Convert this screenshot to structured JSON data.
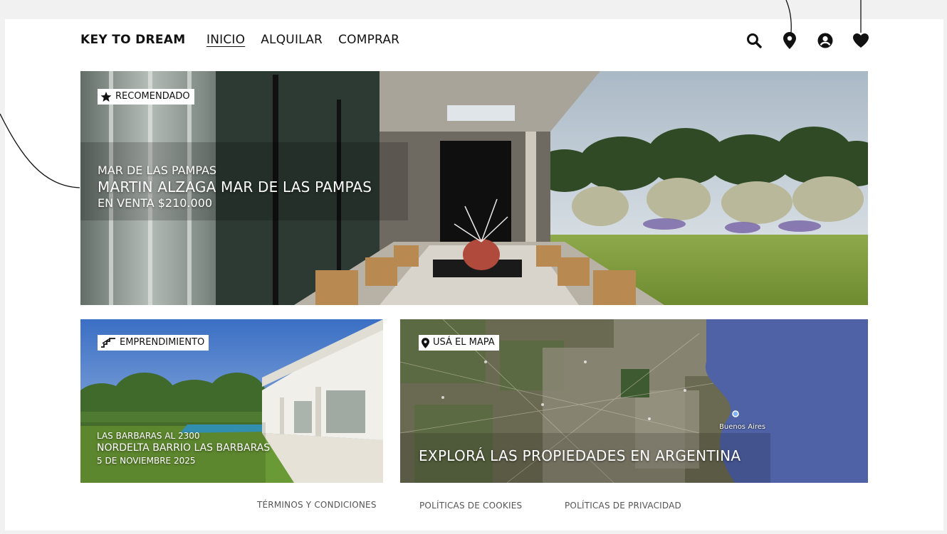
{
  "header": {
    "brand": "KEY TO DREAM",
    "nav": [
      "INICIO",
      "ALQUILAR",
      "COMPRAR"
    ],
    "active_nav": "INICIO",
    "icons": [
      "search-icon",
      "map-pin-icon",
      "user-icon",
      "heart-icon"
    ]
  },
  "featured": {
    "tag": "RECOMENDADO",
    "tag_icon": "star-icon",
    "location": "MAR DE LAS PAMPAS",
    "title": "MARTIN ALZAGA MAR DE LAS PAMPAS",
    "price": "EN VENTA $210.000"
  },
  "development": {
    "tag": "EMPRENDIMIENTO",
    "tag_icon": "stairs-icon",
    "address": "LAS BARBARAS AL 2300",
    "title": "NORDELTA BARRIO LAS BARBARAS",
    "date": "5 DE NOVIEMBRE 2025"
  },
  "map": {
    "tag": "USÁ EL MAPA",
    "tag_icon": "map-pin-icon",
    "title": "EXPLORÁ LAS PROPIEDADES EN ARGENTINA",
    "city_label": "Buenos Aires"
  },
  "footer": {
    "links": [
      "TÉRMINOS Y CONDICIONES",
      "POLÍTICAS DE COOKIES",
      "POLÍTICAS DE PRIVACIDAD"
    ]
  },
  "colors": {
    "background": "#f1f1f1",
    "page": "#ffffff",
    "text": "#111111",
    "footer_text": "#555555",
    "water": "#4f62a6"
  }
}
